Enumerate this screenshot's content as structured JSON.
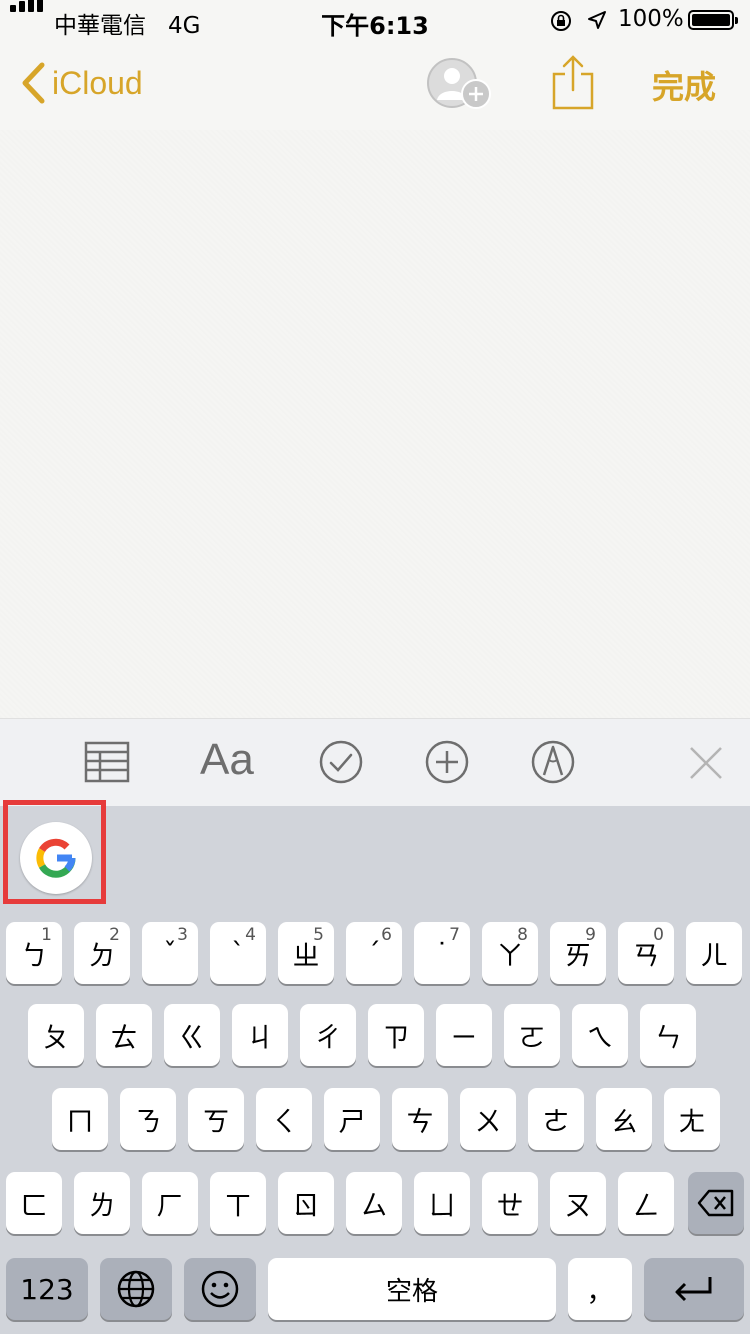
{
  "status_bar": {
    "carrier": "中華電信",
    "network": "4G",
    "time": "下午6:13",
    "battery_pct": "100%"
  },
  "nav": {
    "back_label": "iCloud",
    "done_label": "完成",
    "accent_color": "#d7a529"
  },
  "toolbar": {
    "format_label": "Aa"
  },
  "keyboard": {
    "row1": [
      {
        "char": "ㄅ",
        "num": "1"
      },
      {
        "char": "ㄉ",
        "num": "2"
      },
      {
        "char": "ˇ",
        "num": "3"
      },
      {
        "char": "ˋ",
        "num": "4"
      },
      {
        "char": "ㄓ",
        "num": "5"
      },
      {
        "char": "ˊ",
        "num": "6"
      },
      {
        "char": "˙",
        "num": "7"
      },
      {
        "char": "ㄚ",
        "num": "8"
      },
      {
        "char": "ㄞ",
        "num": "9"
      },
      {
        "char": "ㄢ",
        "num": "0"
      },
      {
        "char": "ㄦ",
        "num": ""
      }
    ],
    "row2": [
      "ㄆ",
      "ㄊ",
      "ㄍ",
      "ㄐ",
      "ㄔ",
      "ㄗ",
      "ㄧ",
      "ㄛ",
      "ㄟ",
      "ㄣ"
    ],
    "row3": [
      "ㄇ",
      "ㄋ",
      "ㄎ",
      "ㄑ",
      "ㄕ",
      "ㄘ",
      "ㄨ",
      "ㄜ",
      "ㄠ",
      "ㄤ"
    ],
    "row4": [
      "ㄈ",
      "ㄌ",
      "ㄏ",
      "ㄒ",
      "ㄖ",
      "ㄙ",
      "ㄩ",
      "ㄝ",
      "ㄡ",
      "ㄥ"
    ],
    "numbers_label": "123",
    "space_label": "空格",
    "comma_label": "，"
  }
}
